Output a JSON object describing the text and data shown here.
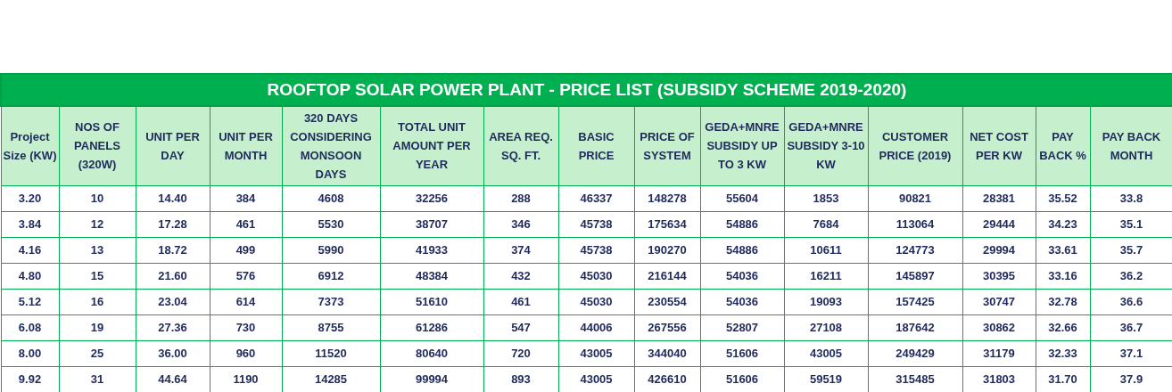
{
  "table": {
    "title": "ROOFTOP SOLAR POWER PLANT - PRICE LIST (SUBSIDY SCHEME 2019-2020)",
    "columns": [
      "Project Size (KW)",
      "NOS OF PANELS (320W)",
      "UNIT PER DAY",
      "UNIT PER MONTH",
      "320 DAYS CONSIDERING MONSOON DAYS",
      "TOTAL UNIT AMOUNT PER YEAR",
      "AREA REQ. SQ. FT.",
      "BASIC PRICE",
      "PRICE  OF SYSTEM",
      "GEDA+MNRE SUBSIDY UP TO 3 KW",
      "GEDA+MNRE SUBSIDY 3-10 KW",
      "CUSTOMER PRICE (2019)",
      "NET COST PER  KW",
      "PAY BACK %",
      "PAY  BACK MONTH"
    ],
    "rows": [
      [
        "3.20",
        "10",
        "14.40",
        "384",
        "4608",
        "32256",
        "288",
        "46337",
        "148278",
        "55604",
        "1853",
        "90821",
        "28381",
        "35.52",
        "33.8"
      ],
      [
        "3.84",
        "12",
        "17.28",
        "461",
        "5530",
        "38707",
        "346",
        "45738",
        "175634",
        "54886",
        "7684",
        "113064",
        "29444",
        "34.23",
        "35.1"
      ],
      [
        "4.16",
        "13",
        "18.72",
        "499",
        "5990",
        "41933",
        "374",
        "45738",
        "190270",
        "54886",
        "10611",
        "124773",
        "29994",
        "33.61",
        "35.7"
      ],
      [
        "4.80",
        "15",
        "21.60",
        "576",
        "6912",
        "48384",
        "432",
        "45030",
        "216144",
        "54036",
        "16211",
        "145897",
        "30395",
        "33.16",
        "36.2"
      ],
      [
        "5.12",
        "16",
        "23.04",
        "614",
        "7373",
        "51610",
        "461",
        "45030",
        "230554",
        "54036",
        "19093",
        "157425",
        "30747",
        "32.78",
        "36.6"
      ],
      [
        "6.08",
        "19",
        "27.36",
        "730",
        "8755",
        "61286",
        "547",
        "44006",
        "267556",
        "52807",
        "27108",
        "187642",
        "30862",
        "32.66",
        "36.7"
      ],
      [
        "8.00",
        "25",
        "36.00",
        "960",
        "11520",
        "80640",
        "720",
        "43005",
        "344040",
        "51606",
        "43005",
        "249429",
        "31179",
        "32.33",
        "37.1"
      ],
      [
        "9.92",
        "31",
        "44.64",
        "1190",
        "14285",
        "99994",
        "893",
        "43005",
        "426610",
        "51606",
        "59519",
        "315485",
        "31803",
        "31.70",
        "37.9"
      ]
    ]
  }
}
